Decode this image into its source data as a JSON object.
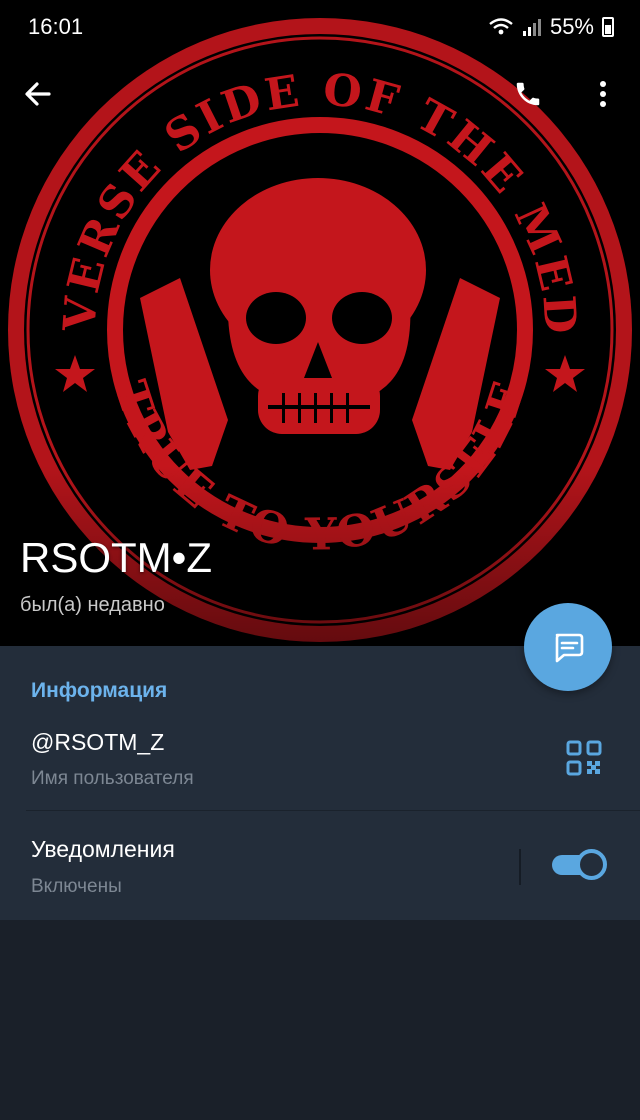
{
  "status_bar": {
    "time": "16:01",
    "battery": "55%"
  },
  "profile": {
    "name": "RSOTM•Z",
    "last_seen": "был(а) недавно",
    "photo_icon": "skull-emblem-photo",
    "photo_text_top": "REVERSE SIDE OF THE MEDAL",
    "photo_text_bottom": "TRUE TO YOURSELF"
  },
  "info": {
    "section_title": "Информация",
    "username": "@RSOTM_Z",
    "username_label": "Имя пользователя",
    "notifications_title": "Уведомления",
    "notifications_state": "Включены",
    "notifications_enabled": true
  },
  "colors": {
    "accent": "#5aa7e0",
    "section_title": "#6cb3ec",
    "emblem_red": "#c4161c",
    "panel": "#232d3a",
    "background": "#1a2029"
  }
}
